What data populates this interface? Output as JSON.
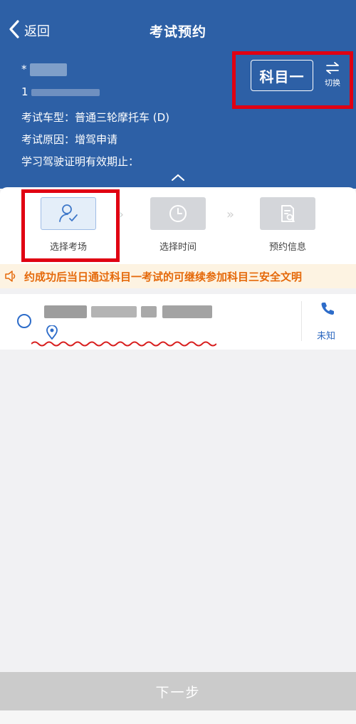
{
  "header": {
    "back_label": "返回",
    "title": "考试预约",
    "subject_button": "科目一",
    "switch_label": "切换",
    "name_masked": "*",
    "id_masked": "1",
    "vehicle_type": "考试车型：普通三轮摩托车 (D)",
    "exam_reason": "考试原因：增驾申请",
    "permit_validity": "学习驾驶证明有效期止："
  },
  "steps": [
    {
      "label": "选择考场",
      "icon": "person-check-icon",
      "active": true
    },
    {
      "label": "选择时间",
      "icon": "clock-icon",
      "active": false
    },
    {
      "label": "预约信息",
      "icon": "document-search-icon",
      "active": false
    }
  ],
  "notice": {
    "icon": "speaker-icon",
    "text": "约成功后当日通过科目一考试的可继续参加科目三安全文明"
  },
  "exam_site": {
    "status": "未知",
    "icons": [
      "location-pin-icon",
      "phone-icon"
    ]
  },
  "footer": {
    "next_label": "下一步"
  },
  "colors": {
    "header_bg": "#2d60a6",
    "accent": "#2d6cc9",
    "notice_text": "#e5690a",
    "highlight": "#e00012",
    "disabled_button": "#cbcbcb"
  }
}
